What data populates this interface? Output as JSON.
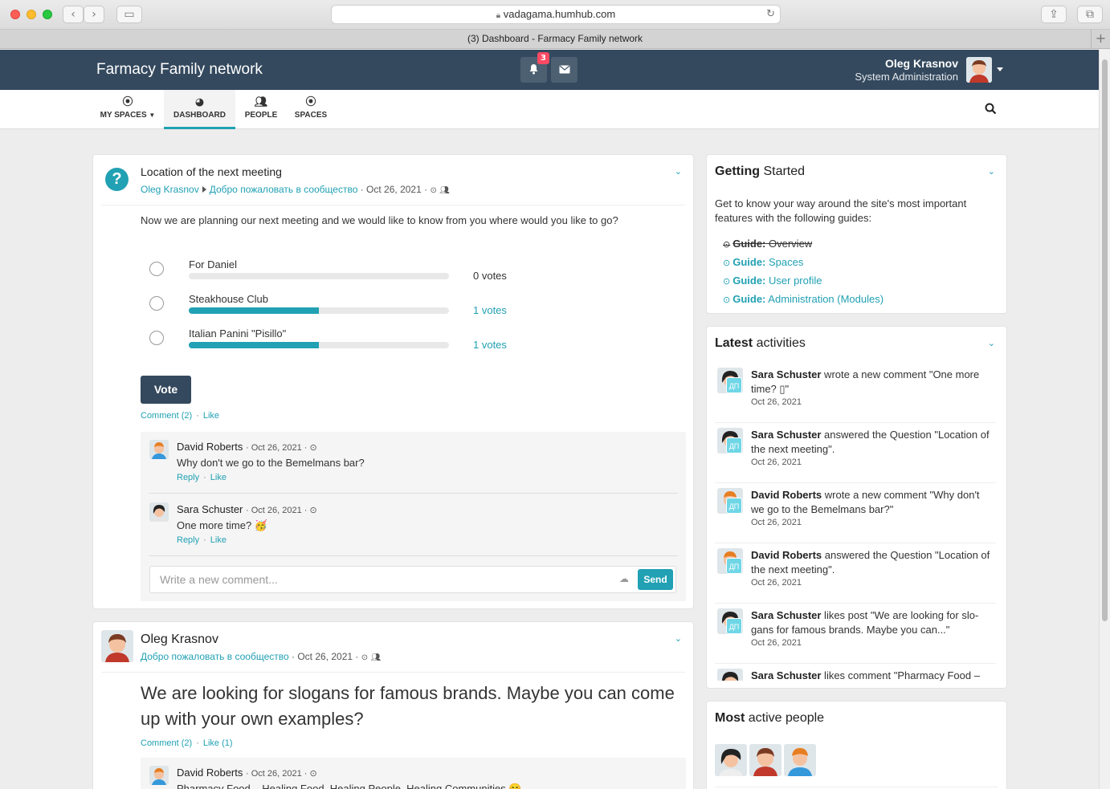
{
  "browser": {
    "url": "vadagama.humhub.com",
    "tab_title": "(3) Dashboard - Farmacy Family network"
  },
  "header": {
    "brand": "Farmacy Family network",
    "notification_count": "3",
    "user_name": "Oleg Krasnov",
    "user_role": "System Administration"
  },
  "nav": {
    "items": [
      {
        "label": "MY SPACES",
        "icon": "dot-circle-icon"
      },
      {
        "label": "DASHBOARD",
        "icon": "dashboard-icon"
      },
      {
        "label": "PEOPLE",
        "icon": "users-icon"
      },
      {
        "label": "SPACES",
        "icon": "dot-circle-icon"
      }
    ]
  },
  "poll_post": {
    "title": "Location of the next meeting",
    "author": "Oleg Krasnov",
    "space": "Добро пожаловать в сообщество",
    "date": "Oct 26, 2021",
    "question": "Now we are planning our next meeting and we would like to know from you where would you like to go?",
    "options": [
      {
        "label": "For Daniel",
        "votes": "0 votes",
        "fraction": 0
      },
      {
        "label": "Steakhouse Club",
        "votes": "1 votes",
        "fraction": 0.5
      },
      {
        "label": "Italian Panini \"Pisillo\"",
        "votes": "1 votes",
        "fraction": 0.5
      }
    ],
    "vote_label": "Vote",
    "comment_link": "Comment (2)",
    "like_link": "Like",
    "comments": [
      {
        "author": "David Roberts",
        "date": "Oct 26, 2021",
        "text": "Why don't we go to the Bemelmans bar?",
        "reply": "Reply",
        "like": "Like"
      },
      {
        "author": "Sara Schuster",
        "date": "Oct 26, 2021",
        "text": "One more time? 🥳",
        "reply": "Reply",
        "like": "Like"
      }
    ],
    "comment_placeholder": "Write a new comment...",
    "send_label": "Send"
  },
  "second_post": {
    "author": "Oleg Krasnov",
    "space": "Добро пожаловать в сообщество",
    "date": "Oct 26, 2021",
    "text": "We are looking for slogans for famous brands. Maybe you can come up with your own examples?",
    "comment_link": "Comment (2)",
    "like_link": "Like (1)",
    "comment": {
      "author": "David Roberts",
      "date": "Oct 26, 2021",
      "text": "Pharmacy Food – Healing Food, Healing People, Healing Communities 😊"
    }
  },
  "getting_started": {
    "title_bold": "Getting",
    "title_rest": " Started",
    "intro": "Get to know your way around the site's most important features with the following guides:",
    "guides": [
      {
        "prefix": "Guide:",
        "label": "Overview",
        "done": true
      },
      {
        "prefix": "Guide:",
        "label": "Spaces",
        "done": false
      },
      {
        "prefix": "Guide:",
        "label": "User profile",
        "done": false
      },
      {
        "prefix": "Guide:",
        "label": "Administration (Modules)",
        "done": false
      }
    ]
  },
  "latest_activities": {
    "title_bold": "Latest",
    "title_rest": " activities",
    "space_badge": "ДП",
    "items": [
      {
        "user": "Sara Schuster",
        "text": " wrote a new comment \"One more time? ▯\"",
        "date": "Oct 26, 2021"
      },
      {
        "user": "Sara Schuster",
        "text": " answered the Question \"Location of the next meeting\".",
        "date": "Oct 26, 2021"
      },
      {
        "user": "David Roberts",
        "text": " wrote a new comment \"Why don't we go to the Bemelmans bar?\"",
        "date": "Oct 26, 2021"
      },
      {
        "user": "David Roberts",
        "text": " answered the Question \"Loca­tion of the next meeting\".",
        "date": "Oct 26, 2021"
      },
      {
        "user": "Sara Schuster",
        "text": " likes post \"We are looking for slo­gans for famous brands. Maybe you can...\"",
        "date": "Oct 26, 2021"
      },
      {
        "user": "Sara Schuster",
        "text": " likes comment \"Pharmacy Food –",
        "date": ""
      }
    ]
  },
  "most_active": {
    "title_bold": "Most",
    "title_rest": " active people"
  },
  "colors": {
    "accent": "#21a1b3",
    "header_bg": "#34495e",
    "badge": "#fc4a64"
  }
}
